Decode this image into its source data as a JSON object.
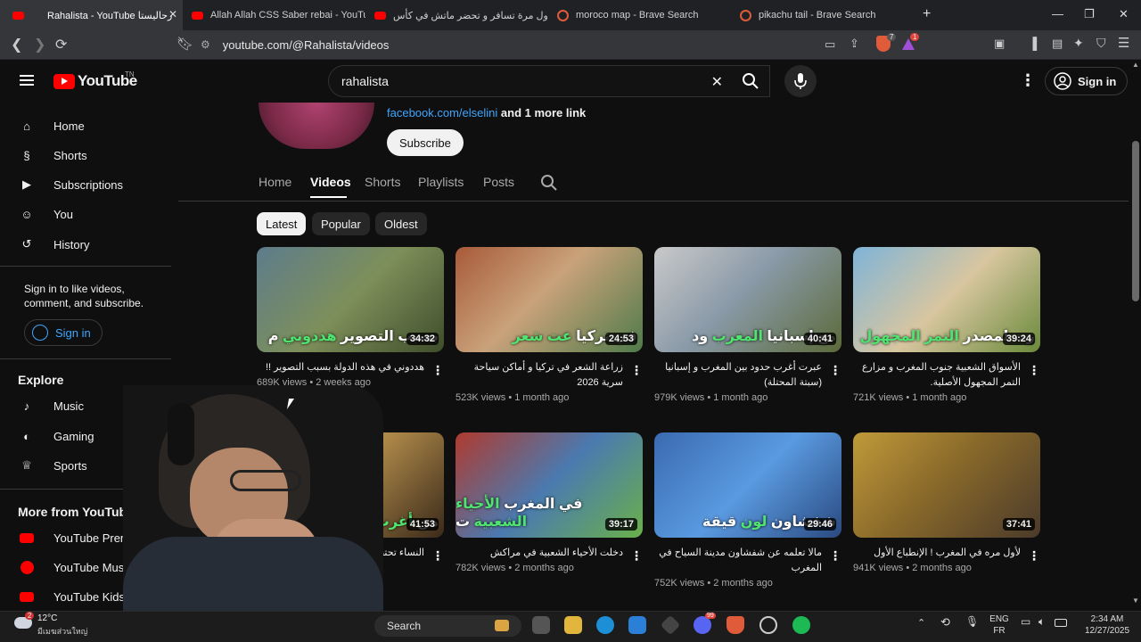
{
  "browser": {
    "tabs": [
      {
        "title": "Rahalista - YouTube رحاليستا",
        "icon": "youtube-favicon"
      },
      {
        "title": "Allah Allah CSS Saber rebai - YouTub",
        "icon": "youtube-favicon"
      },
      {
        "title": "أول مرة تسافر و تحضر ماتش في كأس",
        "icon": "youtube-favicon"
      },
      {
        "title": "moroco map - Brave Search",
        "icon": "brave-search-favicon"
      },
      {
        "title": "pikachu tail - Brave Search",
        "icon": "brave-search-favicon"
      }
    ],
    "url": "youtube.com/@Rahalista/videos",
    "shields_count": "7",
    "rewards_count": "1"
  },
  "youtube": {
    "logo": "YouTube",
    "logo_region": "TN",
    "search_value": "rahalista",
    "sign_in": "Sign in"
  },
  "sidebar": {
    "items": [
      "Home",
      "Shorts",
      "Subscriptions",
      "You",
      "History"
    ],
    "signin_prompt": "Sign in to like videos, comment, and subscribe.",
    "signin_button": "Sign in",
    "explore_title": "Explore",
    "explore_items": [
      "Music",
      "Gaming",
      "Sports"
    ],
    "more_title": "More from YouTube",
    "more_items": [
      "YouTube Premiu",
      "YouTube Music",
      "YouTube Kids"
    ]
  },
  "channel": {
    "link": "facebook.com/elselini",
    "more_links": "and 1 more link",
    "subscribe": "Subscribe",
    "tabs": [
      "Home",
      "Videos",
      "Shorts",
      "Playlists",
      "Posts"
    ],
    "filters": [
      "Latest",
      "Popular",
      "Oldest"
    ]
  },
  "videos": [
    {
      "title": "هددوني في هذه الدولة بسبب التصوير !!",
      "views": "689K views",
      "age": "2 weeks ago",
      "duration": "34:32",
      "overlay_a": "هددوني",
      "overlay_b": "م ",
      "overlay_c": "بسبب التصوير",
      "bg": "linear-gradient(135deg,#5d7c8c 0%,#7d8f5a 50%,#3f4d2a 100%)"
    },
    {
      "title": "زراعة الشعر في تركيا و أماكن سياحة سرية 2026",
      "views": "523K views",
      "age": "1 month ago",
      "duration": "24:53",
      "overlay_a": "عت شعر",
      "overlay_b": "",
      "overlay_c": "في تركيا",
      "bg": "linear-gradient(135deg,#a85a3a 0%,#c9a27a 45%,#4f7a4a 100%)"
    },
    {
      "title": "عبرت أغرب حدود بين المغرب و إسبانيا (سبتة المحتلة)",
      "views": "979K views",
      "age": "1 month ago",
      "duration": "40:41",
      "overlay_a": "المغرب",
      "overlay_b": "ود",
      "overlay_c": "مع إسبانيا",
      "bg": "linear-gradient(135deg,#c9c9c9 0%,#8a9aa8 45%,#5b6a3a 100%)"
    },
    {
      "title": "الأسواق الشعبية جنوب المغرب و مزارع التمر المجهول الأصلية.",
      "views": "721K views",
      "age": "1 month ago",
      "duration": "39:24",
      "overlay_a": "التمر المجهول",
      "overlay_b": "",
      "overlay_c": "رت لمصدر",
      "bg": "linear-gradient(135deg,#7fb4d8 0%,#d8c6a0 50%,#6a8a3a 100%)"
    },
    {
      "title": "النساء تحتف",
      "views": "",
      "age": "",
      "duration": "41:53",
      "overlay_a": "أغرب",
      "overlay_b": "أرى",
      "overlay_c": "من",
      "bg": "linear-gradient(135deg,#8a6a3a 0%,#b08a4a 45%,#3a2a1a 100%)"
    },
    {
      "title": "دخلت الأحياء الشعبية في مراكش",
      "views": "782K views",
      "age": "2 months ago",
      "duration": "39:17",
      "overlay_a": "الأحياء الشعبية",
      "overlay_b": "ت",
      "overlay_c": "في المغرب",
      "bg": "linear-gradient(135deg,#b03a2e 0%,#4a7ab0 50%,#6ab04a 100%)"
    },
    {
      "title": "مالا تعلمه عن شفشاون مدينة السياح في المغرب",
      "views": "752K views",
      "age": "2 months ago",
      "duration": "29:46",
      "overlay_a": "لون",
      "overlay_b": "قيقة",
      "overlay_c": "شفشاون",
      "bg": "linear-gradient(135deg,#3a6ab0 0%,#5a9ae0 50%,#2a4a80 100%)"
    },
    {
      "title": "لأول مره في المغرب ! الإنطباع الأول",
      "views": "941K views",
      "age": "2 months ago",
      "duration": "37:41",
      "overlay_a": "",
      "overlay_b": "",
      "overlay_c": "",
      "bg": "linear-gradient(135deg,#c09a3a 0%,#8a6a2a 45%,#4a3a2a 100%)"
    }
  ],
  "taskbar": {
    "weather_temp": "12°C",
    "weather_desc": "มีเมฆส่วนใหญ่",
    "weather_badge": "2",
    "search_label": "Search",
    "discord_badge": "99",
    "lang": "ENG",
    "lang_region": "FR",
    "time": "2:34 AM",
    "date": "12/27/2025"
  }
}
